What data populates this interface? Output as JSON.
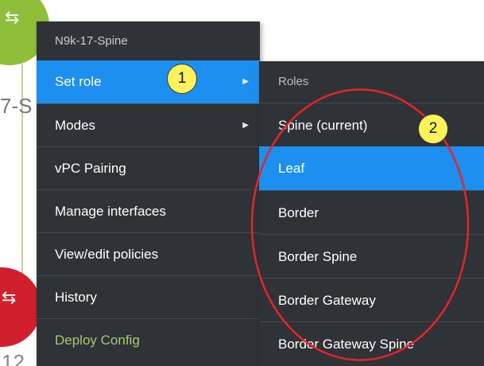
{
  "background": {
    "label_top": "7-S",
    "label_bottom": "12"
  },
  "menu": {
    "header": "N9k-17-Spine",
    "items": [
      {
        "label": "Set role",
        "has_submenu": true,
        "active": true
      },
      {
        "label": "Modes",
        "has_submenu": true
      },
      {
        "label": "vPC Pairing"
      },
      {
        "label": "Manage interfaces"
      },
      {
        "label": "View/edit policies"
      },
      {
        "label": "History"
      },
      {
        "label": "Deploy Config",
        "accent": true
      }
    ]
  },
  "submenu": {
    "header": "Roles",
    "items": [
      {
        "label": "Spine (current)"
      },
      {
        "label": "Leaf",
        "active": true
      },
      {
        "label": "Border"
      },
      {
        "label": "Border Spine"
      },
      {
        "label": "Border Gateway"
      },
      {
        "label": "Border Gateway Spine"
      }
    ]
  },
  "annotations": {
    "badge_1": "1",
    "badge_2": "2",
    "badge_color": "#fff25a",
    "ellipse_color": "#e5252a"
  },
  "colors": {
    "menu_bg": "#2f3236",
    "highlight": "#1d8ff0",
    "node_top": "#8fbf3a",
    "node_bottom": "#d0202e",
    "deploy_text": "#a8c96a"
  },
  "icons": {
    "switch": "switch-arrows-icon",
    "submenu_arrow": "triangle-right-icon"
  }
}
